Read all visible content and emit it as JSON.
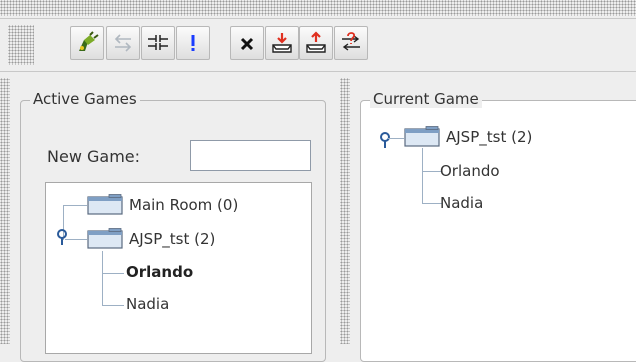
{
  "toolbar": {
    "buttons": [
      {
        "name": "connect-button",
        "icon": "plug-icon"
      },
      {
        "name": "swap-button",
        "icon": "swap-arrows-icon",
        "disabled": true
      },
      {
        "name": "split-button",
        "icon": "split-icon"
      },
      {
        "name": "alert-button",
        "icon": "exclamation-icon"
      },
      {
        "name": "close-game-button",
        "icon": "x-icon"
      },
      {
        "name": "download-button",
        "icon": "inbox-down-icon"
      },
      {
        "name": "upload-button",
        "icon": "inbox-up-icon"
      },
      {
        "name": "transfer-button",
        "icon": "transfer-question-icon"
      }
    ]
  },
  "active_games": {
    "title": "Active Games",
    "new_game_label": "New Game:",
    "new_game_value": "",
    "tree": {
      "rooms": [
        {
          "label": "Main Room (0)",
          "expanded": false
        },
        {
          "label": "AJSP_tst (2)",
          "expanded": true,
          "children": [
            {
              "label": "Orlando",
              "bold": true
            },
            {
              "label": "Nadia",
              "bold": false
            }
          ]
        }
      ]
    }
  },
  "current_game": {
    "title": "Current Game",
    "tree": {
      "room": {
        "label": "AJSP_tst (2)",
        "expanded": true
      },
      "children": [
        {
          "label": "Orlando"
        },
        {
          "label": "Nadia"
        }
      ]
    }
  },
  "colors": {
    "background": "#eeeeee",
    "tree_background": "#ffffff",
    "tree_line": "#9db0c4",
    "folder": "#7f9fc4",
    "accent_blue": "#1a3cff",
    "accent_red": "#e03020"
  }
}
